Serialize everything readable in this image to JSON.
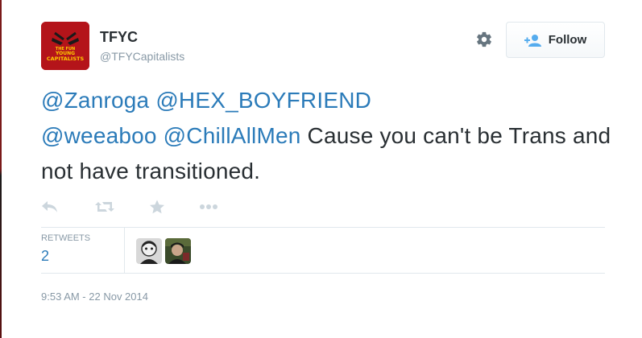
{
  "author": {
    "name": "TFYC",
    "handle": "@TFYCapitalists",
    "avatar_alt": "THE FUN YOUNG CAPITALISTS"
  },
  "follow_button": {
    "label": "Follow"
  },
  "tweet": {
    "segments": [
      {
        "text": "@Zanroga",
        "type": "mention"
      },
      {
        "text": " ",
        "type": "text"
      },
      {
        "text": "@HEX_BOYFRIEND",
        "type": "mention"
      },
      {
        "text": " ",
        "type": "text"
      },
      {
        "text": "@weeaboo",
        "type": "mention"
      },
      {
        "text": " ",
        "type": "text"
      },
      {
        "text": "@ChillAllMen",
        "type": "mention"
      },
      {
        "text": " Cause you can't be Trans and not have transitioned.",
        "type": "text"
      }
    ]
  },
  "stats": {
    "retweets_label": "RETWEETS",
    "retweets_count": "2"
  },
  "timestamp": "9:53 AM - 22 Nov 2014",
  "icons": {
    "reply": "reply-icon",
    "retweet": "retweet-icon",
    "favorite": "star-icon",
    "more": "more-icon",
    "settings": "gear-icon",
    "follow": "add-user-icon"
  },
  "colors": {
    "link": "#2b7bb9",
    "text": "#292f33",
    "muted": "#8899a6",
    "avatar_bg": "#b4141a"
  }
}
